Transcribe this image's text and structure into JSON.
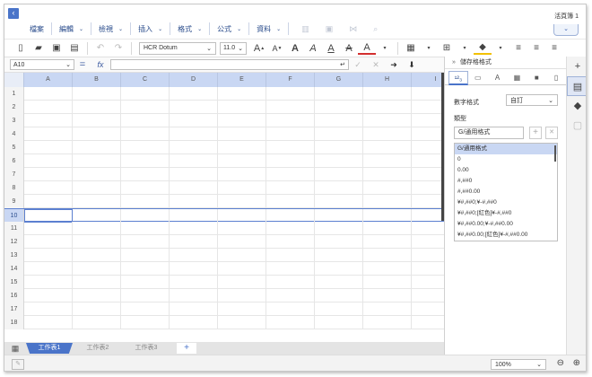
{
  "window": {
    "title": "活頁簿 1",
    "back_glyph": "‹",
    "collapse_glyph": "⌄"
  },
  "menu": {
    "items": [
      {
        "label": "檔案",
        "chevron": false
      },
      {
        "label": "編輯",
        "chevron": true
      },
      {
        "label": "檢視",
        "chevron": true
      },
      {
        "label": "插入",
        "chevron": true
      },
      {
        "label": "格式",
        "chevron": true
      },
      {
        "label": "公式",
        "chevron": true
      },
      {
        "label": "資料",
        "chevron": true
      }
    ],
    "chevron_glyph": "⌄"
  },
  "toolbar": {
    "font": "HCR Dotum",
    "font_size": "11.0",
    "dropdown_glyph": "⌄",
    "icons": {
      "new": "🗋",
      "open": "📂",
      "save": "💾",
      "print": "🖨",
      "grow": "A",
      "shrink": "A",
      "bold": "A",
      "italic": "A",
      "underline": "A",
      "strike": "A",
      "color": "A"
    },
    "font_color": "#d32f2f",
    "fill_color": "#f2c100"
  },
  "formula_bar": {
    "name_box": "A10",
    "eq": "=",
    "fx": "fx",
    "value": ""
  },
  "grid": {
    "columns": [
      "A",
      "B",
      "C",
      "D",
      "E",
      "F",
      "G",
      "H",
      "I"
    ],
    "rows": [
      "1",
      "2",
      "3",
      "4",
      "5",
      "6",
      "7",
      "8",
      "9",
      "10",
      "11",
      "12",
      "13",
      "14",
      "15",
      "16",
      "17",
      "18"
    ],
    "selected_row": "10"
  },
  "sheets": {
    "tabs": [
      "工作表1",
      "工作表2",
      "工作表3"
    ],
    "active": "工作表1",
    "add_glyph": "+"
  },
  "status": {
    "zoom": "100%",
    "zoom_out": "⊖",
    "zoom_in": "⊕"
  },
  "panel": {
    "title": "儲存格格式",
    "hide_glyph": "»",
    "tabs": [
      "¹²₃",
      "▭",
      "A",
      "▦",
      "■",
      "▯"
    ],
    "number_format_label": "數字格式",
    "number_format_value": "自訂",
    "type_label": "類型",
    "type_value": "G/通用格式",
    "formats": [
      "G/通用格式",
      "0",
      "0.00",
      "#,##0",
      "#,##0.00",
      "¥#,##0;¥-#,##0",
      "¥#,##0;[紅色]¥-#,##0",
      "¥#,##0.00;¥-#,##0.00",
      "¥#,##0.00;[紅色]¥-#,##0.00"
    ],
    "add_glyph": "+",
    "delete_glyph": "✕"
  },
  "rail": {
    "add": "+",
    "format": "▤",
    "tag": "◆",
    "page": "▢"
  }
}
